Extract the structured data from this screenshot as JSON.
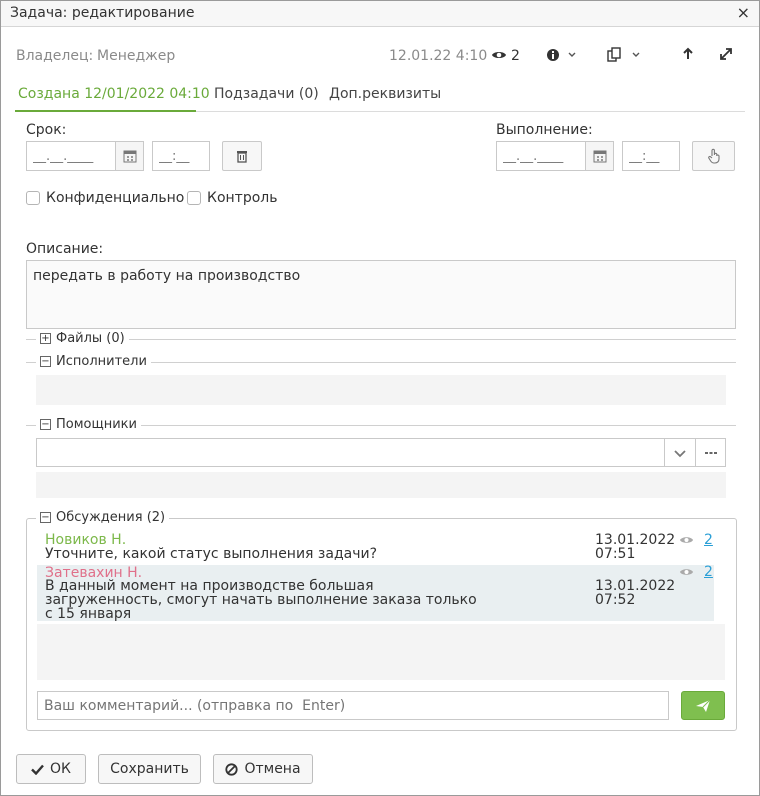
{
  "window": {
    "title": "Задача: редактирование",
    "close": "×"
  },
  "header": {
    "owner_label": "Владелец:",
    "owner_value": "Менеджер",
    "datetime": "12.01.22 4:10",
    "views": "2"
  },
  "tabs": [
    {
      "label": "Создана 12/01/2022 04:10",
      "active": true
    },
    {
      "label": "Подзадачи (0)"
    },
    {
      "label": "Доп.реквизиты"
    }
  ],
  "deadline": {
    "label": "Срок:",
    "date_placeholder": "__.__.____",
    "time_placeholder": "__:__"
  },
  "completion": {
    "label": "Выполнение:",
    "date_placeholder": "__.__.____",
    "time_placeholder": "__:__"
  },
  "checkboxes": {
    "confidential": "Конфиденциально",
    "control": "Контроль"
  },
  "description": {
    "label": "Описание:",
    "text": "передать в работу на производство"
  },
  "groups": {
    "files": "Файлы (0)",
    "executors": "Исполнители",
    "helpers": "Помощники",
    "discussions": "Обсуждения (2)"
  },
  "discussion": [
    {
      "author": "Новиков Н.",
      "author_color": "#7cb84a",
      "text_lines": [
        "Уточните, какой статус выполнения задачи?"
      ],
      "date": "13.01.2022",
      "time": "07:51",
      "count": "2"
    },
    {
      "author": "Затевахин Н.",
      "author_color": "#e0708a",
      "text_lines": [
        "В данный момент на производстве большая",
        "загруженность, смогут начать выполнение заказа только",
        "с 15 января"
      ],
      "date": "13.01.2022",
      "time": "07:52",
      "count": "2"
    }
  ],
  "comment": {
    "placeholder": "Ваш комментарий... (отправка по  Enter)"
  },
  "buttons": {
    "ok": "ОК",
    "save": "Сохранить",
    "cancel": "Отмена"
  },
  "colors": {
    "accent": "#6aaa3a",
    "link": "#2a9fd6",
    "send_button": "#7fbf4f"
  }
}
